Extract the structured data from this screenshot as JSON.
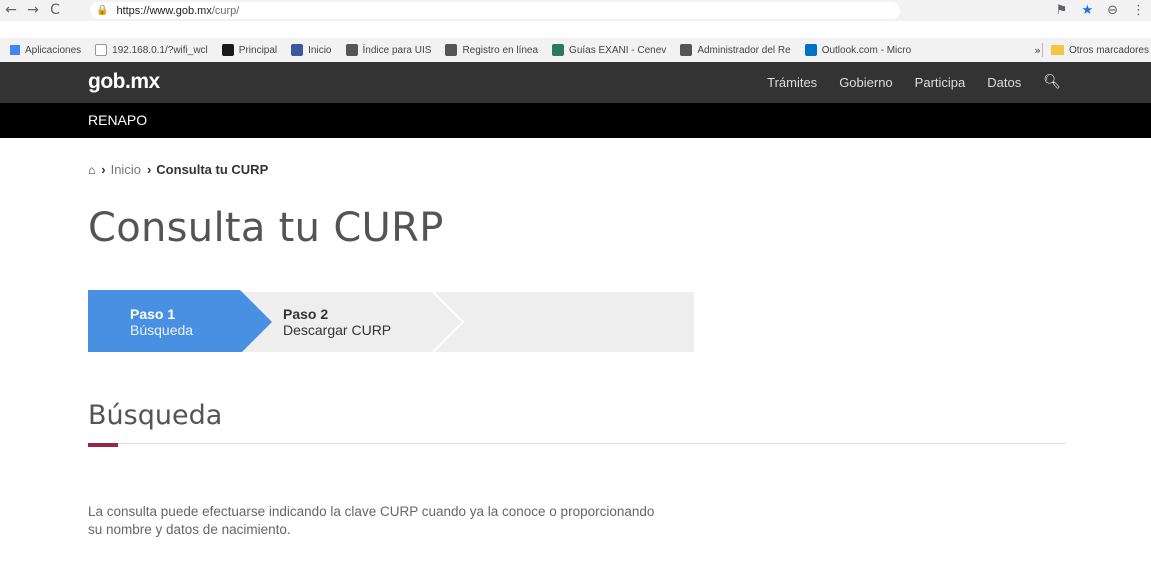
{
  "browser": {
    "url_host": "https://www.gob.mx",
    "url_path": "/curp/",
    "bookmarks": [
      {
        "label": "Aplicaciones",
        "color": "#4285f4"
      },
      {
        "label": "192.168.0.1/?wifi_wcl",
        "color": "#bbbbbb"
      },
      {
        "label": "Principal",
        "color": "#1a1a1a"
      },
      {
        "label": "Inicio",
        "color": "#3c5a99"
      },
      {
        "label": "Índice para UIS",
        "color": "#555555"
      },
      {
        "label": "Registro en línea",
        "color": "#555555"
      },
      {
        "label": "Guías EXANI - Cenev",
        "color": "#2b7a5f"
      },
      {
        "label": "Administrador del Re",
        "color": "#555555"
      },
      {
        "label": "Outlook.com - Micro",
        "color": "#0072c6"
      }
    ],
    "more": "»",
    "other_bookmarks": "Otros marcadores"
  },
  "header": {
    "logo": "gob.mx",
    "nav": [
      "Trámites",
      "Gobierno",
      "Participa",
      "Datos"
    ],
    "subbar": "RENAPO"
  },
  "breadcrumb": {
    "inicio": "Inicio",
    "current": "Consulta tu CURP"
  },
  "page_title": "Consulta tu CURP",
  "steps": [
    {
      "number": "Paso 1",
      "label": "Búsqueda",
      "active": true,
      "color": "#4a90e2"
    },
    {
      "number": "Paso 2",
      "label": "Descargar CURP",
      "active": false,
      "color": "#eeeeee"
    }
  ],
  "section_title": "Búsqueda",
  "accent_color": "#9d2449",
  "description": "La consulta puede efectuarse indicando la clave CURP cuando ya la conoce o proporcionando su nombre y datos de nacimiento."
}
